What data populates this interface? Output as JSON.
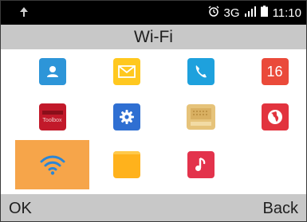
{
  "status_bar": {
    "signal_text": "3G",
    "time": "11:10"
  },
  "title": "Wi-Fi",
  "apps": [
    {
      "name": "contacts",
      "icon": "contacts-icon",
      "color": "#2d95d8"
    },
    {
      "name": "messages",
      "icon": "envelope-icon",
      "color": "#ffc81f"
    },
    {
      "name": "phone",
      "icon": "phone-icon",
      "color": "#1ea1dd"
    },
    {
      "name": "calendar",
      "icon": "calendar-icon",
      "color": "#ea4a3a",
      "text": "16"
    },
    {
      "name": "toolbox",
      "icon": "toolbox-icon",
      "color": "#c2192a",
      "text": "Toolbox"
    },
    {
      "name": "settings",
      "icon": "gear-icon",
      "color": "#2f6fd2"
    },
    {
      "name": "radio",
      "icon": "radio-icon",
      "color": "#e6c37a"
    },
    {
      "name": "browser",
      "icon": "globe-icon",
      "color": "#e2333e"
    },
    {
      "name": "wifi",
      "icon": "wifi-icon",
      "color": "#f6a54a",
      "selected": true
    },
    {
      "name": "files",
      "icon": "folder-icon",
      "color": "#ffb21c"
    },
    {
      "name": "music",
      "icon": "music-note-icon",
      "color": "#e3334c"
    }
  ],
  "softkeys": {
    "left": "OK",
    "right": "Back"
  }
}
